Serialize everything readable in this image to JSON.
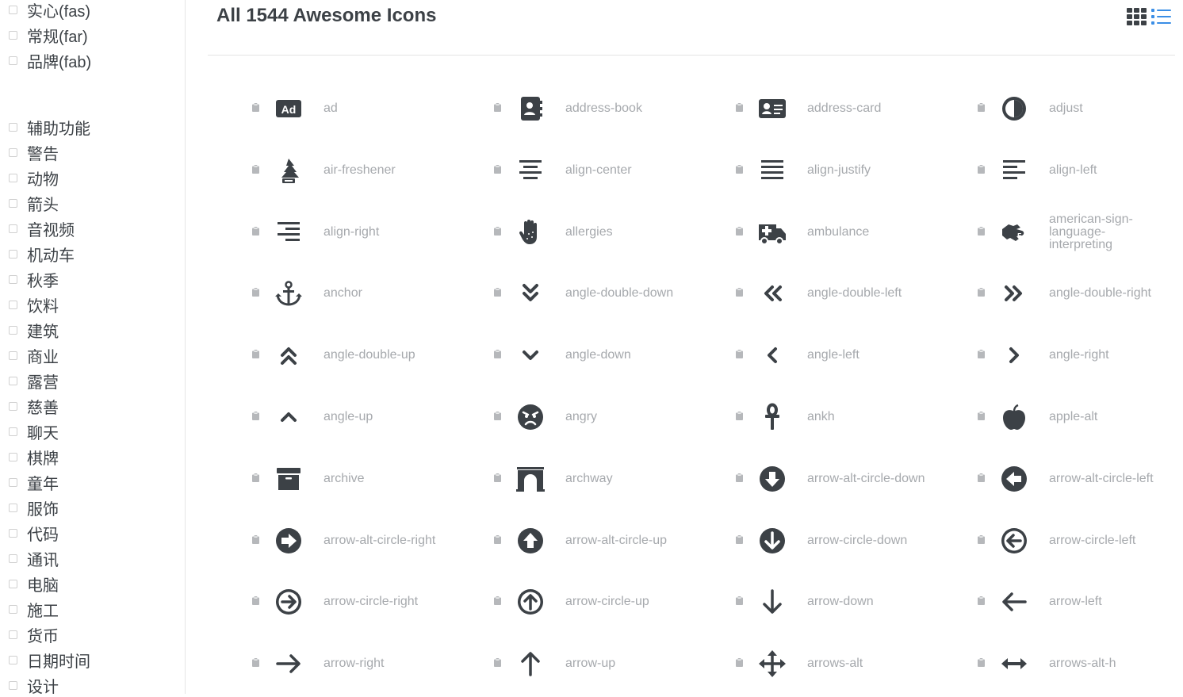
{
  "sidebar": {
    "styles": [
      "实心(fas)",
      "常规(far)",
      "品牌(fab)"
    ],
    "categories": [
      "辅助功能",
      "警告",
      "动物",
      "箭头",
      "音视频",
      "机动车",
      "秋季",
      "饮料",
      "建筑",
      "商业",
      "露营",
      "慈善",
      "聊天",
      "棋牌",
      "童年",
      "服饰",
      "代码",
      "通讯",
      "电脑",
      "施工",
      "货币",
      "日期时间",
      "设计"
    ]
  },
  "header": {
    "title": "All 1544 Awesome Icons"
  },
  "icons": [
    {
      "name": "ad",
      "icon": "ad-icon"
    },
    {
      "name": "address-book",
      "icon": "address-book-icon"
    },
    {
      "name": "address-card",
      "icon": "address-card-icon"
    },
    {
      "name": "adjust",
      "icon": "adjust-icon"
    },
    {
      "name": "air-freshener",
      "icon": "air-freshener-icon"
    },
    {
      "name": "align-center",
      "icon": "align-center-icon"
    },
    {
      "name": "align-justify",
      "icon": "align-justify-icon"
    },
    {
      "name": "align-left",
      "icon": "align-left-icon"
    },
    {
      "name": "align-right",
      "icon": "align-right-icon"
    },
    {
      "name": "allergies",
      "icon": "allergies-icon"
    },
    {
      "name": "ambulance",
      "icon": "ambulance-icon"
    },
    {
      "name": "american-sign-language-interpreting",
      "icon": "american-sign-language-interpreting-icon"
    },
    {
      "name": "anchor",
      "icon": "anchor-icon"
    },
    {
      "name": "angle-double-down",
      "icon": "angle-double-down-icon"
    },
    {
      "name": "angle-double-left",
      "icon": "angle-double-left-icon"
    },
    {
      "name": "angle-double-right",
      "icon": "angle-double-right-icon"
    },
    {
      "name": "angle-double-up",
      "icon": "angle-double-up-icon"
    },
    {
      "name": "angle-down",
      "icon": "angle-down-icon"
    },
    {
      "name": "angle-left",
      "icon": "angle-left-icon"
    },
    {
      "name": "angle-right",
      "icon": "angle-right-icon"
    },
    {
      "name": "angle-up",
      "icon": "angle-up-icon"
    },
    {
      "name": "angry",
      "icon": "angry-icon"
    },
    {
      "name": "ankh",
      "icon": "ankh-icon"
    },
    {
      "name": "apple-alt",
      "icon": "apple-alt-icon"
    },
    {
      "name": "archive",
      "icon": "archive-icon"
    },
    {
      "name": "archway",
      "icon": "archway-icon"
    },
    {
      "name": "arrow-alt-circle-down",
      "icon": "arrow-alt-circle-down-icon"
    },
    {
      "name": "arrow-alt-circle-left",
      "icon": "arrow-alt-circle-left-icon"
    },
    {
      "name": "arrow-alt-circle-right",
      "icon": "arrow-alt-circle-right-icon"
    },
    {
      "name": "arrow-alt-circle-up",
      "icon": "arrow-alt-circle-up-icon"
    },
    {
      "name": "arrow-circle-down",
      "icon": "arrow-circle-down-icon"
    },
    {
      "name": "arrow-circle-left",
      "icon": "arrow-circle-left-icon"
    },
    {
      "name": "arrow-circle-right",
      "icon": "arrow-circle-right-icon"
    },
    {
      "name": "arrow-circle-up",
      "icon": "arrow-circle-up-icon"
    },
    {
      "name": "arrow-down",
      "icon": "arrow-down-icon"
    },
    {
      "name": "arrow-left",
      "icon": "arrow-left-icon"
    },
    {
      "name": "arrow-right",
      "icon": "arrow-right-icon"
    },
    {
      "name": "arrow-up",
      "icon": "arrow-up-icon"
    },
    {
      "name": "arrows-alt",
      "icon": "arrows-alt-icon"
    },
    {
      "name": "arrows-alt-h",
      "icon": "arrows-alt-h-icon"
    }
  ],
  "colors": {
    "icon": "#3c4146",
    "name": "#a6a9ad",
    "accent": "#3a8ee6"
  },
  "toolbar_icons": [
    "grid-view-icon",
    "list-view-icon"
  ]
}
